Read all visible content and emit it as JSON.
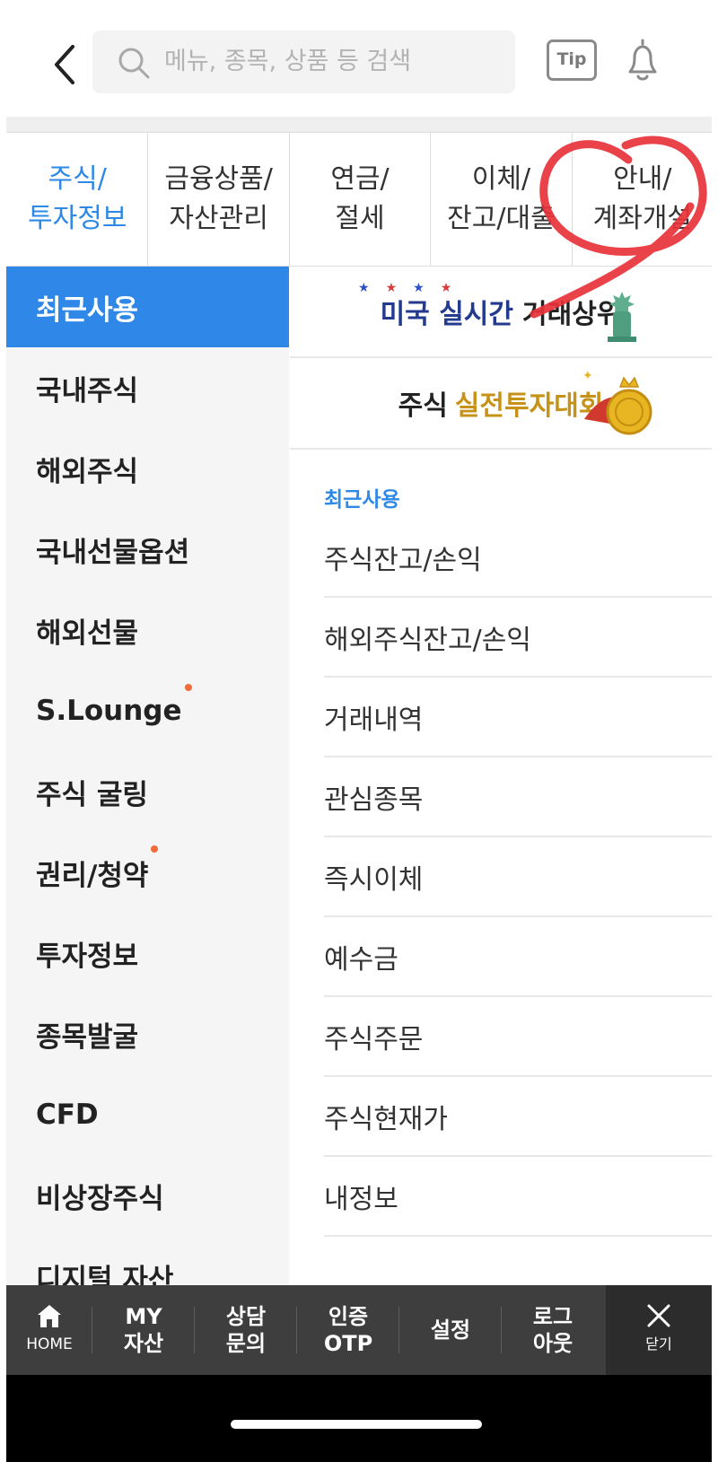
{
  "header": {
    "search_placeholder": "메뉴, 종목, 상품 등 검색",
    "tip_label": "Tip"
  },
  "tabs": [
    {
      "line1": "주식/",
      "line2": "투자정보",
      "active": true
    },
    {
      "line1": "금융상품/",
      "line2": "자산관리",
      "active": false
    },
    {
      "line1": "연금/",
      "line2": "절세",
      "active": false
    },
    {
      "line1": "이체/",
      "line2": "잔고/대출",
      "active": false
    },
    {
      "line1": "안내/",
      "line2": "계좌개설",
      "active": false
    }
  ],
  "sidebar": {
    "items": [
      {
        "label": "최근사용"
      },
      {
        "label": "국내주식"
      },
      {
        "label": "해외주식"
      },
      {
        "label": "국내선물옵션"
      },
      {
        "label": "해외선물"
      },
      {
        "label": "S.Lounge"
      },
      {
        "label": "주식 굴링"
      },
      {
        "label": "권리/청약"
      },
      {
        "label": "투자정보"
      },
      {
        "label": "종목발굴"
      },
      {
        "label": "CFD"
      },
      {
        "label": "비상장주식"
      },
      {
        "label": "디지털 자산"
      }
    ]
  },
  "banners": [
    {
      "highlight": "미국 실시간",
      "text": "거래상위"
    },
    {
      "text": "주식",
      "highlight": "실전투자대회"
    }
  ],
  "recent": {
    "title": "최근사용",
    "items": [
      "주식잔고/손익",
      "해외주식잔고/손익",
      "거래내역",
      "관심종목",
      "즉시이체",
      "예수금",
      "주식주문",
      "주식현재가",
      "내정보"
    ]
  },
  "bottombar": {
    "home": "HOME",
    "items": [
      {
        "line1": "MY",
        "line2": "자산"
      },
      {
        "line1": "상담",
        "line2": "문의"
      },
      {
        "line1": "인증",
        "line2": "OTP"
      },
      {
        "line1": "설정",
        "line2": ""
      },
      {
        "line1": "로그",
        "line2": "아웃"
      }
    ],
    "close": "닫기"
  },
  "colors": {
    "accent": "#2f87e8",
    "annotation": "#e8323a",
    "bottombar": "#3e3e3e"
  }
}
